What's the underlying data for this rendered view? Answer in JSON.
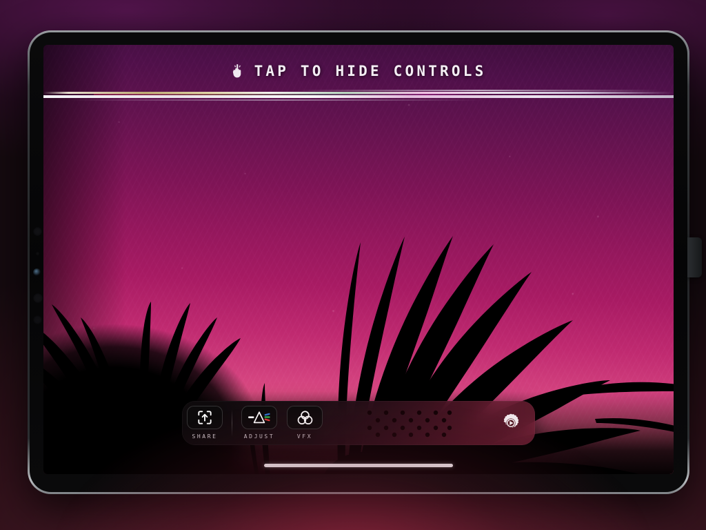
{
  "device": {
    "name": "tablet",
    "bezel_color": "#7d8185",
    "frame_color": "#0a0a0b"
  },
  "hud": {
    "tap_icon": "tap-hand-icon",
    "title": "TAP TO HIDE CONTROLS"
  },
  "photo": {
    "subject": "palm frond silhouettes at sunset",
    "gradient_top": "#3d0e3c",
    "gradient_mid": "#a81b63",
    "gradient_bottom": "#e0567f",
    "silhouette_color": "#000000",
    "glitch_effect": "horizontal-scanline-tear"
  },
  "toolbar": {
    "tools": [
      {
        "id": "share",
        "label": "SHARE",
        "icon": "share-arrow-icon"
      },
      {
        "id": "adjust",
        "label": "ADJUST",
        "icon": "prism-spectrum-icon"
      },
      {
        "id": "vfx",
        "label": "VFX",
        "icon": "three-circles-icon"
      }
    ],
    "drag_handle": {
      "icon": "dot-grid-handle-icon",
      "columns": 6,
      "rows": 4
    },
    "settings": {
      "icon": "gear-play-icon",
      "label": "Settings"
    }
  },
  "system": {
    "home_indicator": "home-indicator-bar"
  },
  "colors": {
    "accent_red": "#e03a3a",
    "accent_green": "#35b14e",
    "accent_blue": "#2f74d0",
    "hud_text": "#f4eef4",
    "label_text": "#cfc6cb"
  }
}
